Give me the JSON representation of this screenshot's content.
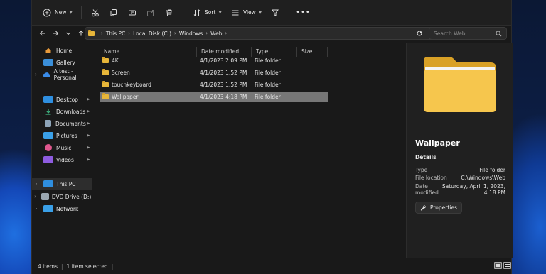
{
  "toolbar": {
    "new_label": "New",
    "sort_label": "Sort",
    "view_label": "View"
  },
  "address": {
    "crumbs": [
      "This PC",
      "Local Disk (C:)",
      "Windows",
      "Web"
    ],
    "search_placeholder": "Search Web"
  },
  "nav": {
    "items": [
      {
        "label": "Home"
      },
      {
        "label": "Gallery"
      },
      {
        "label": "A test - Personal"
      },
      {
        "label": "Desktop"
      },
      {
        "label": "Downloads"
      },
      {
        "label": "Documents"
      },
      {
        "label": "Pictures"
      },
      {
        "label": "Music"
      },
      {
        "label": "Videos"
      },
      {
        "label": "This PC"
      },
      {
        "label": "DVD Drive (D:) CCC"
      },
      {
        "label": "Network"
      }
    ]
  },
  "list": {
    "columns": [
      "Name",
      "Date modified",
      "Type",
      "Size"
    ],
    "rows": [
      {
        "name": "4K",
        "date": "4/1/2023 2:09 PM",
        "type": "File folder",
        "size": ""
      },
      {
        "name": "Screen",
        "date": "4/1/2023 1:52 PM",
        "type": "File folder",
        "size": ""
      },
      {
        "name": "touchkeyboard",
        "date": "4/1/2023 1:52 PM",
        "type": "File folder",
        "size": ""
      },
      {
        "name": "Wallpaper",
        "date": "4/1/2023 4:18 PM",
        "type": "File folder",
        "size": ""
      }
    ]
  },
  "details": {
    "title": "Wallpaper",
    "section": "Details",
    "type_label": "Type",
    "type_value": "File folder",
    "location_label": "File location",
    "location_value": "C:\\Windows\\Web",
    "date_label_1": "Date",
    "date_label_2": "modified",
    "date_value_1": "Saturday, April 1, 2023,",
    "date_value_2": "4:18 PM",
    "properties_label": "Properties"
  },
  "status": {
    "items_count": "4 items",
    "selected": "1 item selected"
  },
  "colors": {
    "folder": "#e7b63a",
    "selected_row": "#777777",
    "window_bg": "#191919"
  }
}
